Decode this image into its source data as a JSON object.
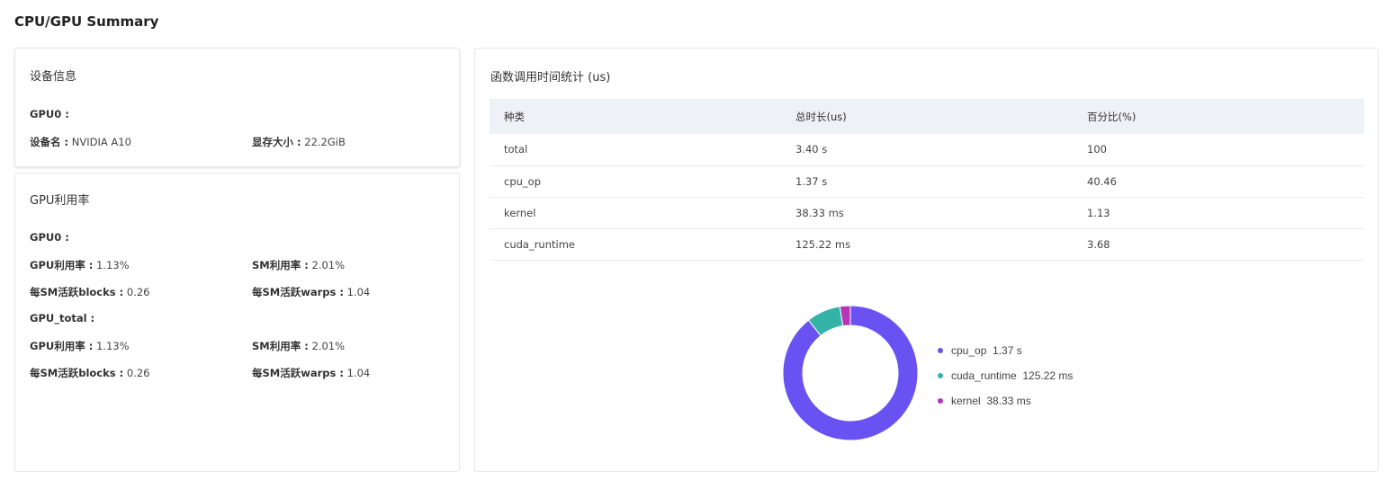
{
  "page_title": "CPU/GPU Summary",
  "device_info": {
    "title": "设备信息",
    "gpu_label": "GPU0 :",
    "name_key": "设备名 :",
    "name_value": "NVIDIA A10",
    "memory_key": "显存大小 :",
    "memory_value": "22.2GiB"
  },
  "gpu_util": {
    "title": "GPU利用率",
    "groups": [
      {
        "label": "GPU0 :",
        "util_key": "GPU利用率 :",
        "util_value": "1.13%",
        "sm_key": "SM利用率 :",
        "sm_value": "2.01%",
        "blocks_key": "每SM活跃blocks :",
        "blocks_value": "0.26",
        "warps_key": "每SM活跃warps :",
        "warps_value": "1.04"
      },
      {
        "label": "GPU_total :",
        "util_key": "GPU利用率 :",
        "util_value": "1.13%",
        "sm_key": "SM利用率 :",
        "sm_value": "2.01%",
        "blocks_key": "每SM活跃blocks :",
        "blocks_value": "0.26",
        "warps_key": "每SM活跃warps :",
        "warps_value": "1.04"
      }
    ]
  },
  "call_stats": {
    "title": "函数调用时间统计 (us)",
    "columns": [
      "种类",
      "总时长(us)",
      "百分比(%)"
    ],
    "rows": [
      [
        "total",
        "3.40 s",
        "100"
      ],
      [
        "cpu_op",
        "1.37 s",
        "40.46"
      ],
      [
        "kernel",
        "38.33 ms",
        "1.13"
      ],
      [
        "cuda_runtime",
        "125.22 ms",
        "3.68"
      ]
    ]
  },
  "chart_data": {
    "type": "pie",
    "donut": true,
    "legend_position": "right",
    "series": [
      {
        "name": "cpu_op",
        "label": "1.37 s",
        "value": 1.37,
        "color": "#6a52f2"
      },
      {
        "name": "cuda_runtime",
        "label": "125.22 ms",
        "value": 0.12522,
        "color": "#34b3a8"
      },
      {
        "name": "kernel",
        "label": "38.33 ms",
        "value": 0.03833,
        "color": "#b535b5"
      }
    ]
  }
}
